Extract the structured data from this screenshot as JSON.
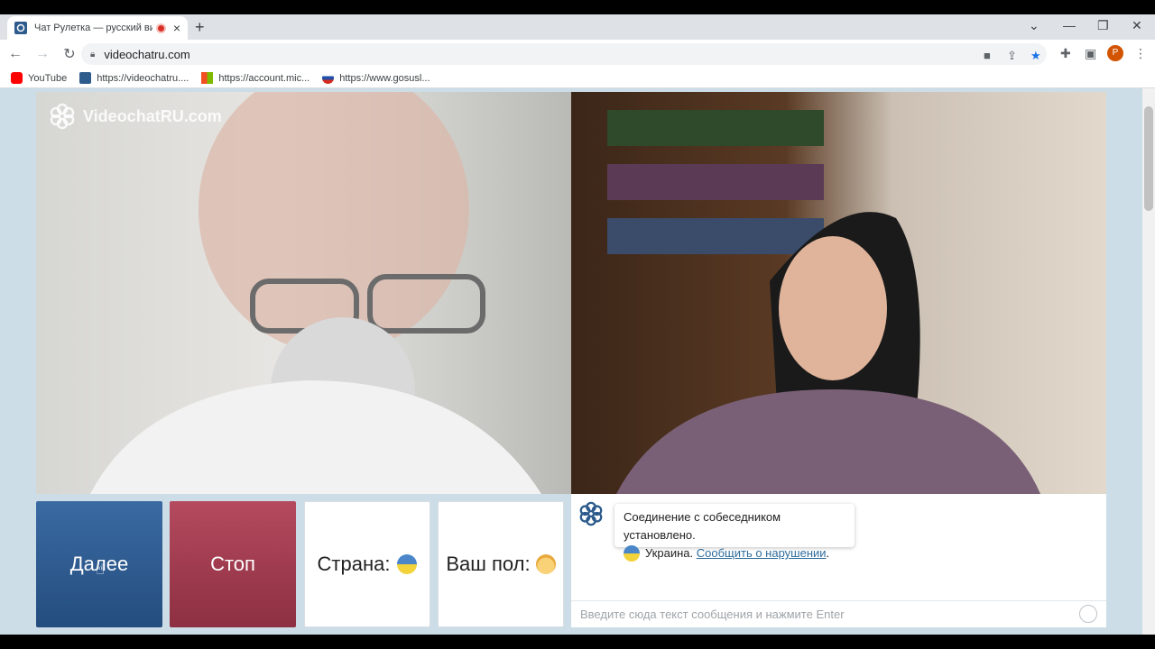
{
  "browser": {
    "tab_title": "Чат Рулетка — русский вид",
    "new_tab": "+",
    "close": "×",
    "url": "videochatru.com",
    "profile_initial": "P",
    "bookmarks": [
      {
        "label": "YouTube",
        "icon": "youtube-icon"
      },
      {
        "label": "https://videochatru....",
        "icon": "videochat-icon"
      },
      {
        "label": "https://account.mic...",
        "icon": "microsoft-icon"
      },
      {
        "label": "https://www.gosusl...",
        "icon": "gosuslugi-icon"
      }
    ]
  },
  "site": {
    "logo_text": "VideochatRU.com"
  },
  "controls": {
    "next": "Далее",
    "stop": "Стоп",
    "country": "Страна:",
    "gender": "Ваш пол:"
  },
  "chat": {
    "connected": "Соединение с собеседником установлено.",
    "country_name": "Украина.",
    "report_link": "Сообщить о нарушении",
    "period": ".",
    "input_placeholder": "Введите сюда текст сообщения и нажмите Enter"
  },
  "colors": {
    "next_btn": "#2f5d93",
    "stop_btn": "#a23d50",
    "page_bg": "#ccdde7",
    "link": "#2d6c9c"
  }
}
